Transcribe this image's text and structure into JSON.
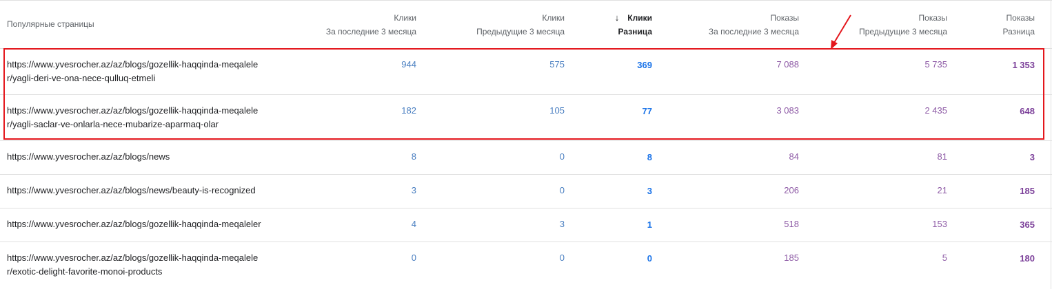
{
  "header": {
    "page_col": "Популярные страницы",
    "cols": [
      {
        "line1": "Клики",
        "line2": "За последние 3 месяца"
      },
      {
        "line1": "Клики",
        "line2": "Предыдущие 3 месяца"
      },
      {
        "line1": "Клики",
        "line2": "Разница",
        "sort_icon": "arrow-down-icon",
        "sorted": true
      },
      {
        "line1": "Показы",
        "line2": "За последние 3 месяца"
      },
      {
        "line1": "Показы",
        "line2": "Предыдущие 3 месяца"
      },
      {
        "line1": "Показы",
        "line2": "Разница"
      }
    ]
  },
  "rows": [
    {
      "page": "https://www.yvesrocher.az/az/blogs/gozellik-haqqinda-meqaleler/yagli-deri-ve-ona-nece-qulluq-etmeli",
      "clicks_last": "944",
      "clicks_prev": "575",
      "clicks_diff": "369",
      "impr_last": "7 088",
      "impr_prev": "5 735",
      "impr_diff": "1 353"
    },
    {
      "page": "https://www.yvesrocher.az/az/blogs/gozellik-haqqinda-meqaleler/yagli-saclar-ve-onlarla-nece-mubarize-aparmaq-olar",
      "clicks_last": "182",
      "clicks_prev": "105",
      "clicks_diff": "77",
      "impr_last": "3 083",
      "impr_prev": "2 435",
      "impr_diff": "648"
    },
    {
      "page": "https://www.yvesrocher.az/az/blogs/news",
      "clicks_last": "8",
      "clicks_prev": "0",
      "clicks_diff": "8",
      "impr_last": "84",
      "impr_prev": "81",
      "impr_diff": "3"
    },
    {
      "page": "https://www.yvesrocher.az/az/blogs/news/beauty-is-recognized",
      "clicks_last": "3",
      "clicks_prev": "0",
      "clicks_diff": "3",
      "impr_last": "206",
      "impr_prev": "21",
      "impr_diff": "185"
    },
    {
      "page": "https://www.yvesrocher.az/az/blogs/gozellik-haqqinda-meqaleler",
      "clicks_last": "4",
      "clicks_prev": "3",
      "clicks_diff": "1",
      "impr_last": "518",
      "impr_prev": "153",
      "impr_diff": "365"
    },
    {
      "page": "https://www.yvesrocher.az/az/blogs/gozellik-haqqinda-meqaleler/exotic-delight-favorite-monoi-products",
      "clicks_last": "0",
      "clicks_prev": "0",
      "clicks_diff": "0",
      "impr_last": "185",
      "impr_prev": "5",
      "impr_diff": "180"
    }
  ],
  "colors": {
    "clicks": "#1a73e8",
    "impressions": "#7b3f99",
    "highlight": "#e4161c"
  }
}
